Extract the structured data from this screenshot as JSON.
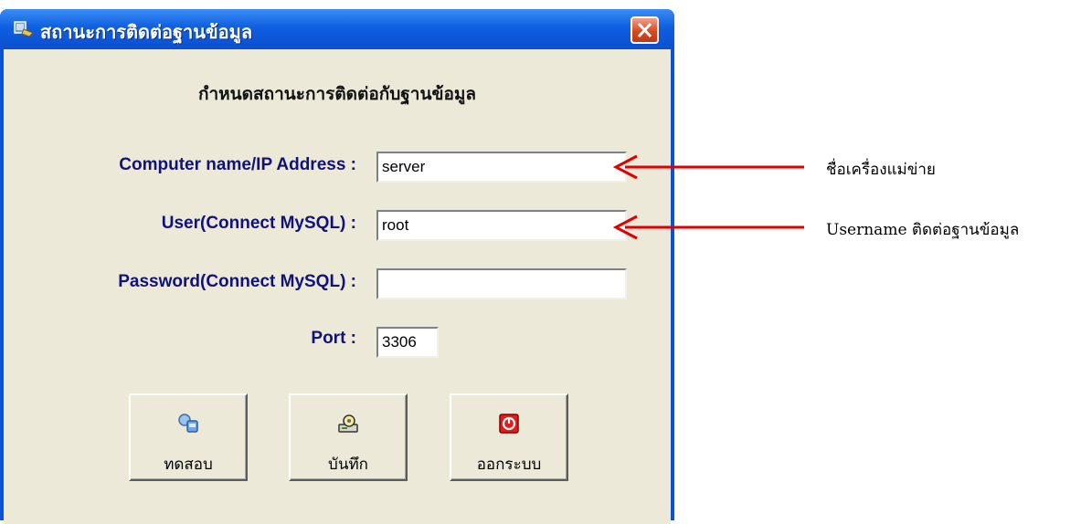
{
  "window": {
    "title": "สถานะการติดต่อฐานข้อมูล",
    "header": "กำหนดสถานะการติดต่อกับฐานข้อมูล"
  },
  "form": {
    "computer_label": "Computer name/IP Address :",
    "computer_value": "server",
    "user_label": "User(Connect MySQL) :",
    "user_value": "root",
    "password_label": "Password(Connect MySQL) :",
    "password_value": "",
    "port_label": "Port :",
    "port_value": "3306"
  },
  "buttons": {
    "test": "ทดสอบ",
    "save": "บันทึก",
    "exit": "ออกระบบ"
  },
  "annotations": {
    "server_note": "ชื่อเครื่องแม่ข่าย",
    "user_note": "Username ติดต่อฐานข้อมูล"
  },
  "colors": {
    "titlebar": "#0b50d0",
    "arrow": "#e00000",
    "label": "#10127a"
  }
}
